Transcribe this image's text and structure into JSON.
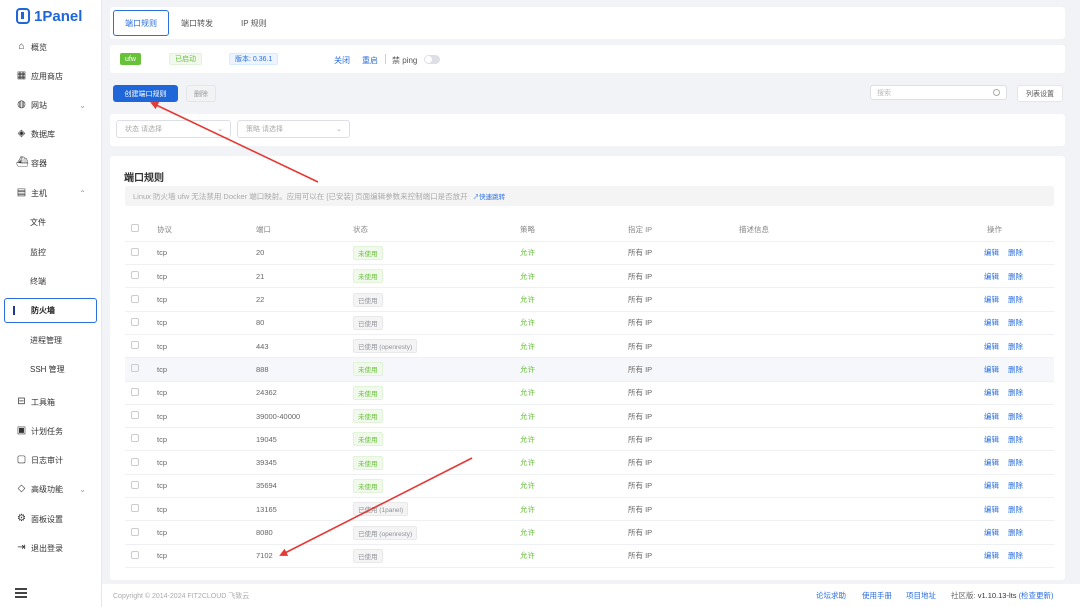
{
  "app": {
    "name": "1Panel"
  },
  "sidebar": {
    "items": [
      {
        "label": "概览",
        "icon": "home-icon"
      },
      {
        "label": "应用商店",
        "icon": "grid-icon"
      },
      {
        "label": "网站",
        "icon": "globe-icon"
      },
      {
        "label": "数据库",
        "icon": "database-icon"
      },
      {
        "label": "容器",
        "icon": "container-icon"
      },
      {
        "label": "主机",
        "icon": "host-icon"
      },
      {
        "label": "文件",
        "icon": ""
      },
      {
        "label": "监控",
        "icon": ""
      },
      {
        "label": "终端",
        "icon": ""
      },
      {
        "label": "防火墙",
        "icon": ""
      },
      {
        "label": "进程管理",
        "icon": ""
      },
      {
        "label": "SSH 管理",
        "icon": ""
      },
      {
        "label": "工具箱",
        "icon": "toolbox-icon"
      },
      {
        "label": "计划任务",
        "icon": "calendar-icon"
      },
      {
        "label": "日志审计",
        "icon": "log-icon"
      },
      {
        "label": "高级功能",
        "icon": "diamond-icon"
      },
      {
        "label": "面板设置",
        "icon": "settings-icon"
      },
      {
        "label": "退出登录",
        "icon": "logout-icon"
      }
    ]
  },
  "tabs": [
    "端口规则",
    "端口转发",
    "IP 规则"
  ],
  "status_bar": {
    "firewall": "ufw",
    "status": "已启动",
    "version": "版本: 0.36.1",
    "stop": "关闭",
    "restart": "重启",
    "ping_label": "禁 ping"
  },
  "toolbar": {
    "create": "创建端口规则",
    "delete": "删除",
    "search_placeholder": "搜索",
    "list_settings": "列表设置"
  },
  "filters": {
    "status_placeholder": "状态 请选择",
    "strategy_placeholder": "策略 请选择"
  },
  "section": {
    "title": "端口规则",
    "info": "Linux 防火墙 ufw 无法禁用 Docker 端口映射。应用可以在 [已安装] 页面编辑参数来控制端口是否放开",
    "info_link": "↗快速跳转"
  },
  "table": {
    "headers": [
      "协议",
      "端口",
      "状态",
      "策略",
      "指定 IP",
      "描述信息",
      "操作"
    ],
    "edit": "编辑",
    "remove": "删除",
    "rows": [
      {
        "proto": "tcp",
        "port": "20",
        "status": "未使用",
        "used": false,
        "policy": "允许",
        "ip": "所有 IP"
      },
      {
        "proto": "tcp",
        "port": "21",
        "status": "未使用",
        "used": false,
        "policy": "允许",
        "ip": "所有 IP"
      },
      {
        "proto": "tcp",
        "port": "22",
        "status": "已使用",
        "used": true,
        "policy": "允许",
        "ip": "所有 IP"
      },
      {
        "proto": "tcp",
        "port": "80",
        "status": "已使用",
        "used": true,
        "policy": "允许",
        "ip": "所有 IP"
      },
      {
        "proto": "tcp",
        "port": "443",
        "status": "已使用 (openresty)",
        "used": true,
        "policy": "允许",
        "ip": "所有 IP"
      },
      {
        "proto": "tcp",
        "port": "888",
        "status": "未使用",
        "used": false,
        "policy": "允许",
        "ip": "所有 IP"
      },
      {
        "proto": "tcp",
        "port": "24362",
        "status": "未使用",
        "used": false,
        "policy": "允许",
        "ip": "所有 IP"
      },
      {
        "proto": "tcp",
        "port": "39000-40000",
        "status": "未使用",
        "used": false,
        "policy": "允许",
        "ip": "所有 IP"
      },
      {
        "proto": "tcp",
        "port": "19045",
        "status": "未使用",
        "used": false,
        "policy": "允许",
        "ip": "所有 IP"
      },
      {
        "proto": "tcp",
        "port": "39345",
        "status": "未使用",
        "used": false,
        "policy": "允许",
        "ip": "所有 IP"
      },
      {
        "proto": "tcp",
        "port": "35694",
        "status": "未使用",
        "used": false,
        "policy": "允许",
        "ip": "所有 IP"
      },
      {
        "proto": "tcp",
        "port": "13165",
        "status": "已使用 (1panel)",
        "used": true,
        "policy": "允许",
        "ip": "所有 IP"
      },
      {
        "proto": "tcp",
        "port": "8080",
        "status": "已使用 (openresty)",
        "used": true,
        "policy": "允许",
        "ip": "所有 IP"
      },
      {
        "proto": "tcp",
        "port": "7102",
        "status": "已使用",
        "used": true,
        "policy": "允许",
        "ip": "所有 IP"
      }
    ]
  },
  "footer": {
    "copyright": "Copyright © 2014-2024 FIT2CLOUD 飞致云",
    "forum": "论坛求助",
    "manual": "使用手册",
    "project": "项目地址",
    "edition_label": "社区版:",
    "version": "v1.10.13-lts",
    "check_update": "(检查更新)"
  },
  "colors": {
    "accent": "#1f66d8",
    "success": "#67c23a",
    "annotation": "#e53935"
  }
}
